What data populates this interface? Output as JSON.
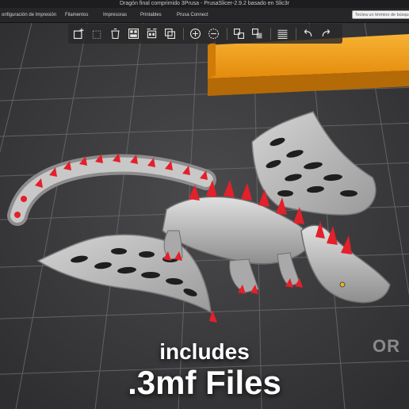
{
  "window": {
    "title": "Dragón final comprimido 3Prusa - PrusaSlicer-2.9.2 basado en Slic3r"
  },
  "tabs": [
    {
      "label": "onfiguración de Impresión"
    },
    {
      "label": "Filamentos"
    },
    {
      "label": "Impresoras"
    },
    {
      "label": "Printables"
    },
    {
      "label": "Prusa Connect"
    }
  ],
  "search": {
    "placeholder": "Teclea un término de búsqueda"
  },
  "toolbar": {
    "tools": [
      "add-object-icon",
      "delete-icon",
      "delete-all-icon",
      "arrange-icon",
      "arrange-selection-icon",
      "copy-icon",
      "paste-icon",
      "add-instance-icon",
      "remove-instance-icon",
      "split-objects-icon",
      "split-parts-icon",
      "layers-icon",
      "undo-icon",
      "redo-icon"
    ]
  },
  "overlay": {
    "line1": "includes",
    "line2": ".3mf Files"
  },
  "bed": {
    "mark": "OR"
  },
  "colors": {
    "accent_orange": "#f39c12",
    "spike_red": "#e4202a",
    "model_grey": "#bdbdbd",
    "bed_grey": "#3a3a3c"
  }
}
